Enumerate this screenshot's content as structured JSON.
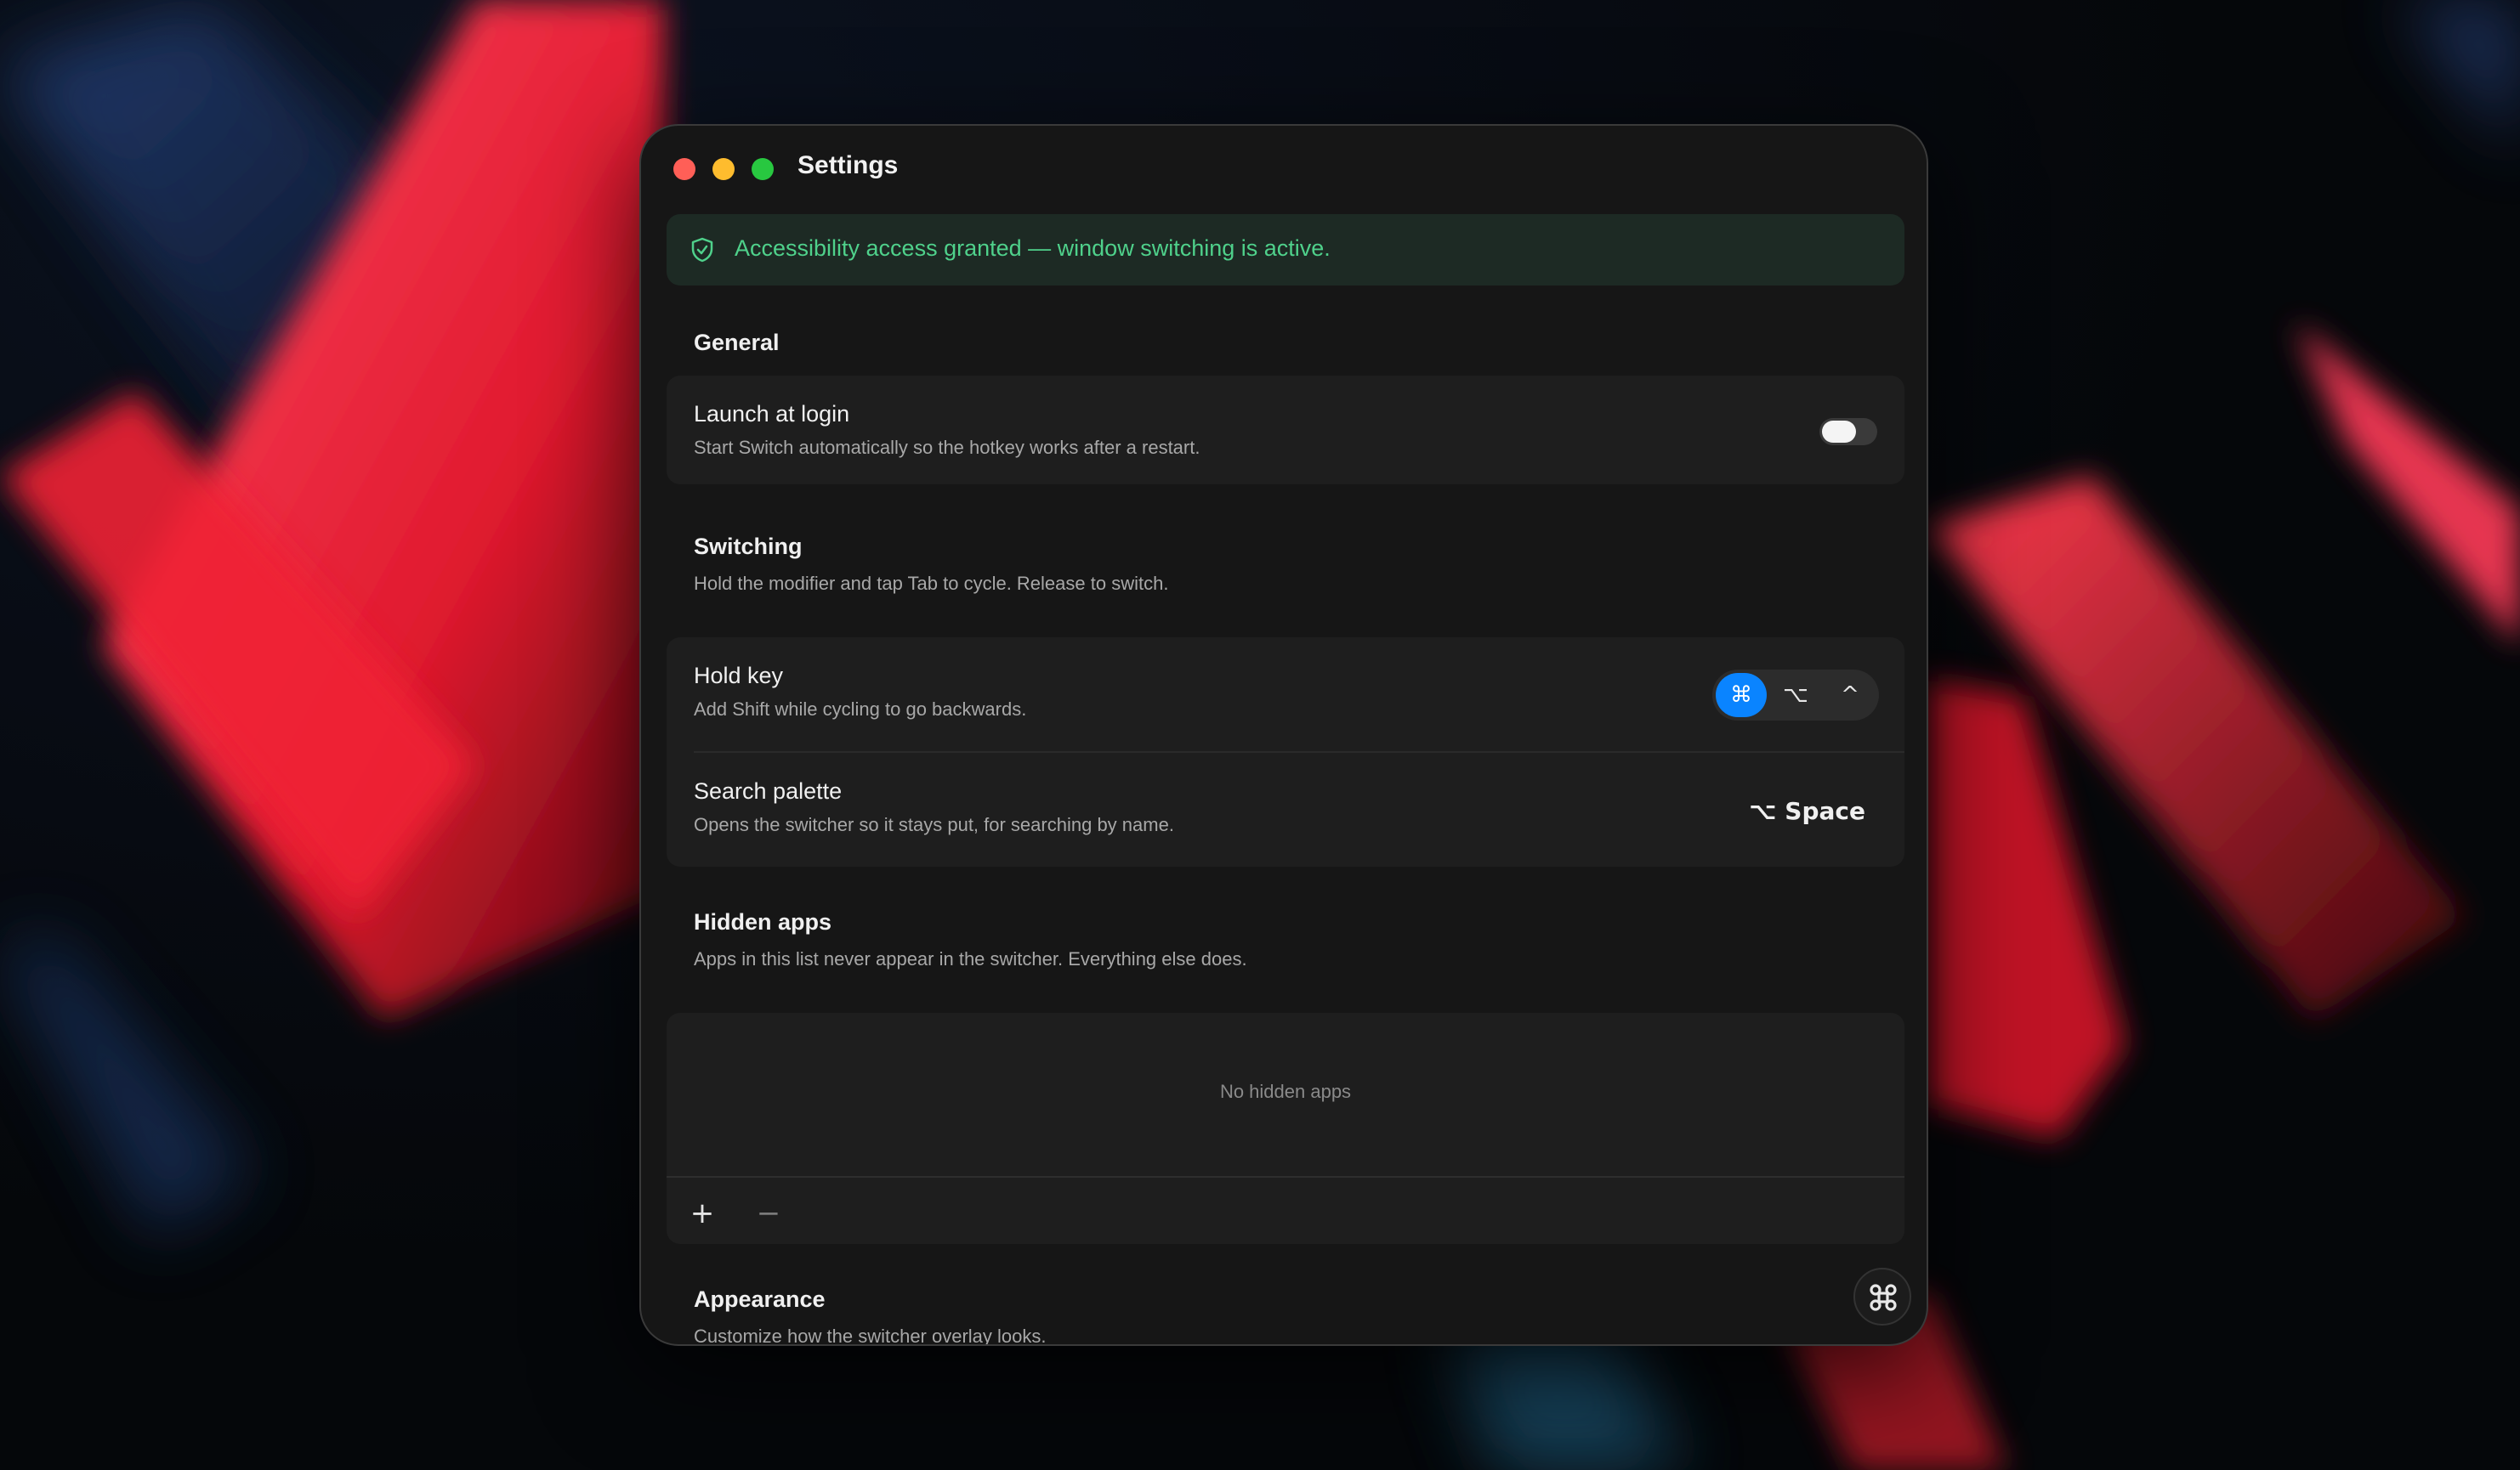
{
  "window": {
    "title": "Settings"
  },
  "banner": {
    "icon": "shield-check-icon",
    "text": "Accessibility access granted — window switching is active.",
    "color": "#4fd18b"
  },
  "general": {
    "title": "General",
    "launch_at_login": {
      "title": "Launch at login",
      "description": "Start Switch automatically so the hotkey works after a restart.",
      "enabled": false
    }
  },
  "switching": {
    "title": "Switching",
    "description": "Hold the modifier and tap Tab to cycle. Release to switch.",
    "hold_key": {
      "title": "Hold key",
      "description": "Add Shift while cycling to go backwards.",
      "options": [
        "⌘",
        "⌥",
        "^"
      ],
      "selected": "⌘",
      "accent": "#0a84ff"
    },
    "search_palette": {
      "title": "Search palette",
      "description": "Opens the switcher so it stays put, for searching by name.",
      "shortcut": "⌥ Space"
    }
  },
  "hidden_apps": {
    "title": "Hidden apps",
    "description": "Apps in this list never appear in the switcher. Everything else does.",
    "empty_label": "No hidden apps",
    "add_label": "+",
    "remove_label": "−"
  },
  "appearance": {
    "title": "Appearance",
    "description": "Customize how the switcher overlay looks."
  },
  "fab": {
    "icon": "command-icon"
  }
}
